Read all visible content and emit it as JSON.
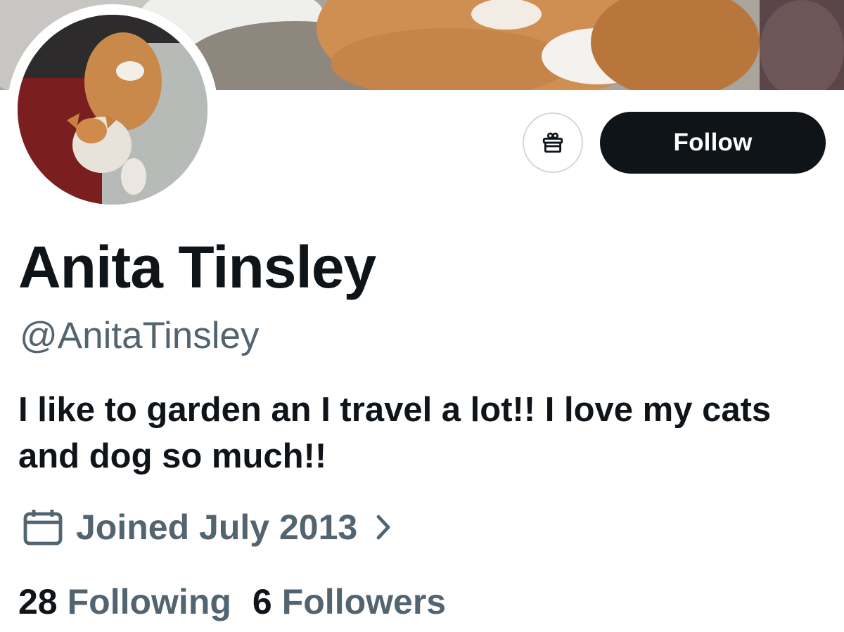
{
  "profile": {
    "display_name": "Anita Tinsley",
    "handle": "@AnitaTinsley",
    "bio": "I like to garden an I travel a lot!! I love my cats and dog so much!!",
    "joined": "Joined July 2013"
  },
  "actions": {
    "follow_label": "Follow",
    "gift_icon": "gift-icon"
  },
  "stats": {
    "following_count": "28",
    "following_label": "Following",
    "followers_count": "6",
    "followers_label": "Followers"
  },
  "icons": {
    "joined": "calendar-icon",
    "chevron": "chevron-right-icon"
  },
  "colors": {
    "text_primary": "#0f1419",
    "text_secondary": "#536471",
    "button_bg": "#0f1419",
    "button_text": "#ffffff",
    "border": "#cfd9de"
  }
}
